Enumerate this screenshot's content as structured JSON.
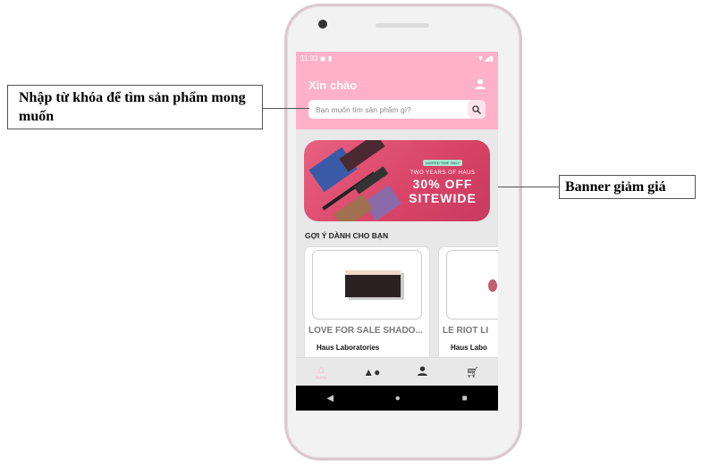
{
  "status_bar": {
    "time": "11:33",
    "icons": [
      "f-icon",
      "sd-card-icon",
      "wifi-icon",
      "signal-icon",
      "battery-icon"
    ]
  },
  "header": {
    "greeting": "Xin chào",
    "search_placeholder": "Bạn muốn tìm sản phẩm gì?"
  },
  "banner": {
    "tag": "LIMITED TIME ONLY",
    "subtitle": "TWO YEARS OF HAUS",
    "headline_1": "30% OFF",
    "headline_2": "SITEWIDE"
  },
  "section_title": "GỢI Ý DÀNH CHO BẠN",
  "products": [
    {
      "name": "LOVE FOR SALE SHADO...",
      "brand": "Haus Laboratories"
    },
    {
      "name": "LE RIOT LI",
      "brand": "Haus Labo"
    }
  ],
  "bottom_nav": [
    {
      "label": "Home",
      "icon": "home-icon",
      "active": true
    },
    {
      "icon": "categories-icon"
    },
    {
      "icon": "user-icon"
    },
    {
      "icon": "cart-icon"
    }
  ],
  "annotations": {
    "search": "Nhập từ khóa để tìm sản phẩm mong muốn",
    "banner": "Banner giảm giá"
  },
  "colors": {
    "primary": "#ffb1c9",
    "background": "#e8e8e8"
  }
}
